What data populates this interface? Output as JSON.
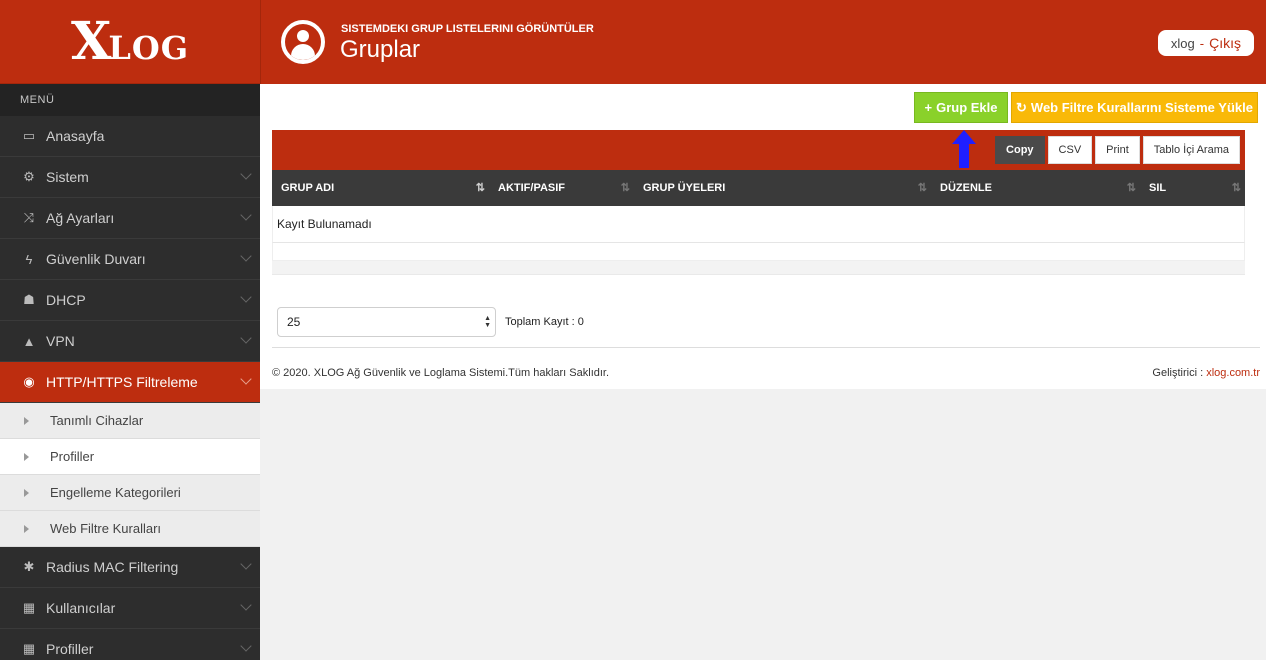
{
  "brand": {
    "logo_big": "X",
    "logo_rest": "LOG"
  },
  "sidebar": {
    "menu_label": "MENÜ",
    "items": [
      {
        "label": "Anasayfa",
        "icon": "laptop-icon",
        "glyph": "▭",
        "active": false,
        "chevron": false
      },
      {
        "label": "Sistem",
        "icon": "gears-icon",
        "glyph": "⚙",
        "active": false,
        "chevron": true
      },
      {
        "label": "Ağ Ayarları",
        "icon": "random-icon",
        "glyph": "⤨",
        "active": false,
        "chevron": true
      },
      {
        "label": "Güvenlik Duvarı",
        "icon": "bolt-icon",
        "glyph": "ϟ",
        "active": false,
        "chevron": true
      },
      {
        "label": "DHCP",
        "icon": "sitemap-icon",
        "glyph": "☗",
        "active": false,
        "chevron": true
      },
      {
        "label": "VPN",
        "icon": "road-icon",
        "glyph": "▲",
        "active": false,
        "chevron": true
      },
      {
        "label": "HTTP/HTTPS Filtreleme",
        "icon": "eye-slash-icon",
        "glyph": "◉",
        "active": true,
        "chevron": true
      }
    ],
    "subitems": [
      {
        "label": "Tanımlı Cihazlar",
        "active": false
      },
      {
        "label": "Profiller",
        "active": true
      },
      {
        "label": "Engelleme Kategorileri",
        "active": false
      },
      {
        "label": "Web Filtre Kuralları",
        "active": false
      }
    ],
    "items_after": [
      {
        "label": "Radius MAC Filtering",
        "icon": "asterisk-icon",
        "glyph": "✱",
        "chevron": true
      },
      {
        "label": "Kullanıcılar",
        "icon": "th-large-icon",
        "glyph": "▦",
        "chevron": true
      },
      {
        "label": "Profiller",
        "icon": "th-large-icon",
        "glyph": "▦",
        "chevron": true
      }
    ]
  },
  "header": {
    "subtitle": "SISTEMDEKI GRUP LISTELERINI GÖRÜNTÜLER",
    "title": "Gruplar",
    "username": "xlog",
    "separator": "-",
    "logout": "Çıkış"
  },
  "toolbar": {
    "add_icon": "+",
    "add_label": "Grup Ekle",
    "load_icon": "↻",
    "load_label": "Web Filtre Kurallarını Sisteme Yükle"
  },
  "table": {
    "export_buttons": [
      "Copy",
      "CSV",
      "Print",
      "Tablo İçi Arama"
    ],
    "columns": [
      {
        "label": "GRUP ADI",
        "sort": "⇅"
      },
      {
        "label": "AKTIF/PASIF",
        "sort": "⇅"
      },
      {
        "label": "GRUP ÜYELERI",
        "sort": "⇅"
      },
      {
        "label": "DÜZENLE",
        "sort": "⇅"
      },
      {
        "label": "SIL",
        "sort": "⇅"
      }
    ],
    "empty_message": "Kayıt Bulunamadı"
  },
  "pager": {
    "page_size": "25",
    "total_label": "Toplam Kayıt : 0"
  },
  "footer": {
    "copyright": "© 2020. XLOG Ağ Güvenlik ve Loglama Sistemi.Tüm hakları Saklıdır.",
    "dev_label": "Geliştirici : ",
    "dev_link": "xlog.com.tr"
  },
  "colors": {
    "brand_red": "#bd2d0f",
    "sidebar_dark": "#2b2b2b",
    "add_green": "#8ad12a",
    "load_yellow": "#f9b908",
    "arrow_blue": "#1f1fff"
  }
}
